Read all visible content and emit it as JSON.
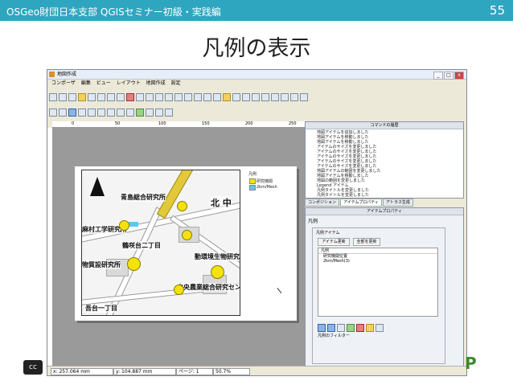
{
  "slide": {
    "header": "OSGeo財団日本支部 QGISセミナー初級・実践編",
    "page_number": "55",
    "title": "凡例の表示",
    "license_badge": "cc",
    "logo_letter": "P"
  },
  "window": {
    "title": "地図作成",
    "controls": {
      "minimize": "_",
      "maximize": "□",
      "close": "x"
    },
    "menu": [
      "コンポーザ",
      "編集",
      "ビュー",
      "レイアウト",
      "地図作成",
      "設定"
    ]
  },
  "ruler": {
    "ticks": [
      "0",
      "50",
      "100",
      "150",
      "200",
      "250"
    ]
  },
  "map": {
    "north_arrow": "north-arrow-icon",
    "labels": {
      "center1": "青島総合研究所",
      "north_kanji": "北 中",
      "left1": "麻村工学研究所",
      "mid1": "鶴咲台二丁目",
      "left2": "物質設研究所",
      "right1": "動環境生物研究所",
      "bottom1": "中央農業総合研究センタ",
      "bottom_left": "吾台一丁目"
    },
    "legend_title": "凡例",
    "legend_items": [
      "研究機関",
      "2km/Mesh"
    ]
  },
  "panels": {
    "command_history_title": "コマンドの履歴",
    "command_history": [
      "地図アイテムを追加しました",
      "地図アイテムを移動しました",
      "地図アイテムを移動しました",
      "アイテムのサイズを変更しました",
      "アイテムのサイズを変更しました",
      "アイテムのサイズを変更しました",
      "アイテムのサイズを変更しました",
      "アイテムのサイズを変更しました",
      "地図アイテムの範囲を変更しました",
      "地図アイテムを移動しました",
      "地図の範囲を変更しました",
      "Legend アイテム",
      "凡例タイトルを変更しました",
      "凡例タイトルを変更しました",
      "Legend item - rename",
      "アイテム位置を変更"
    ],
    "tabs": [
      "コンポジション",
      "アイテムプロパティ",
      "アトラス生成"
    ],
    "active_tab": "アイテムプロパティ",
    "props_header": "アイテムプロパティ",
    "props_section": "凡例",
    "legend_items_group": "凡例アイテム",
    "update_item_button": "アイテム更新",
    "update_all_button": "全部を更新",
    "tree_root": "凡例",
    "tree_rows": [
      "研究機関位置",
      "2km/Mesh(3)"
    ],
    "feature_filter": "凡例のフィルター"
  },
  "status": {
    "x": "x: 257.064 mm",
    "y": "y: 104.887 mm",
    "page": "ページ: 1",
    "zoom": "50.7%"
  }
}
